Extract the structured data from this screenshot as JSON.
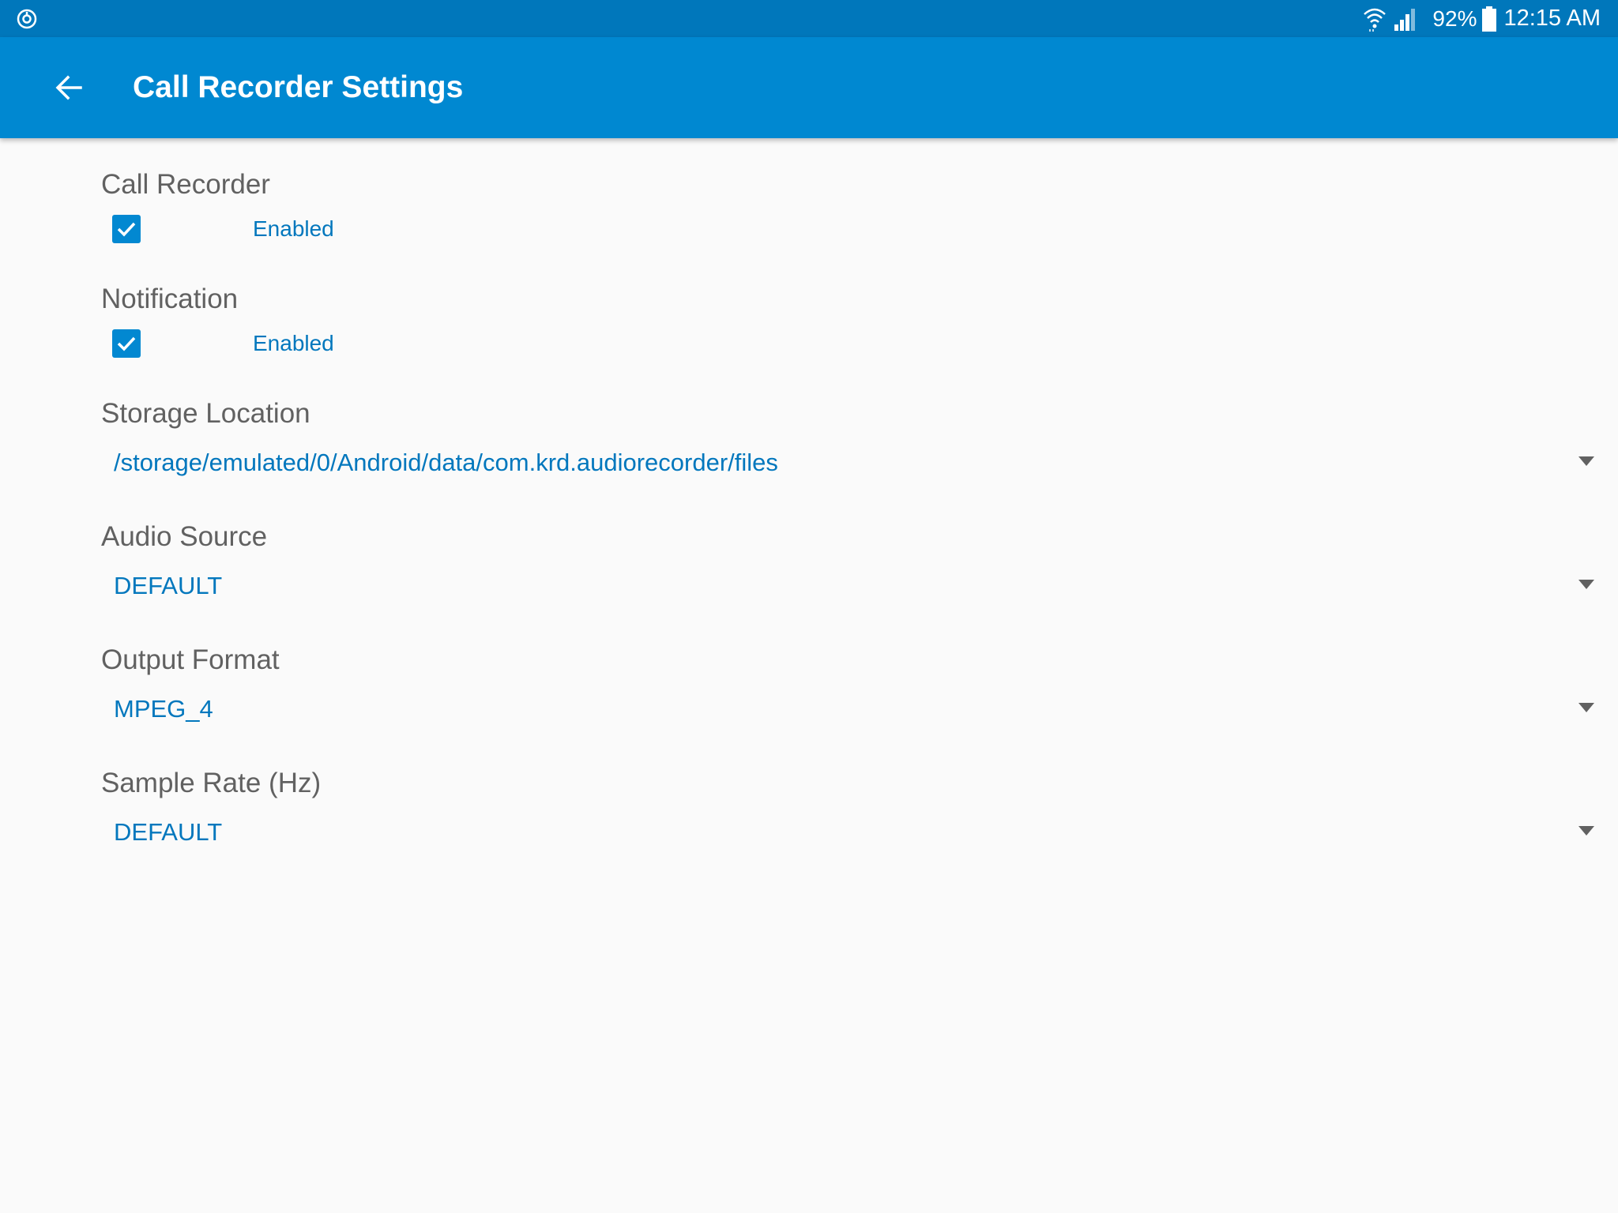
{
  "status_bar": {
    "battery_percent": "92%",
    "time": "12:15 AM"
  },
  "app_bar": {
    "title": "Call Recorder Settings"
  },
  "settings": {
    "call_recorder": {
      "label": "Call Recorder",
      "checked": true,
      "check_label": "Enabled"
    },
    "notification": {
      "label": "Notification",
      "checked": true,
      "check_label": "Enabled"
    },
    "storage_location": {
      "label": "Storage Location",
      "value": "/storage/emulated/0/Android/data/com.krd.audiorecorder/files"
    },
    "audio_source": {
      "label": "Audio Source",
      "value": "DEFAULT"
    },
    "output_format": {
      "label": "Output Format",
      "value": "MPEG_4"
    },
    "sample_rate": {
      "label": "Sample Rate (Hz)",
      "value": "DEFAULT"
    }
  },
  "icons": {
    "status_left": "sync-icon",
    "wifi": "wifi-icon",
    "signal": "cell-signal-icon",
    "battery": "battery-icon",
    "back": "arrow-back-icon",
    "checkbox": "checkmark-icon",
    "dropdown": "dropdown-arrow-icon"
  },
  "colors": {
    "status_bar": "#0077bb",
    "app_bar": "#0088d1",
    "accent": "#0277bd",
    "label": "#616161",
    "background": "#fafafa"
  }
}
